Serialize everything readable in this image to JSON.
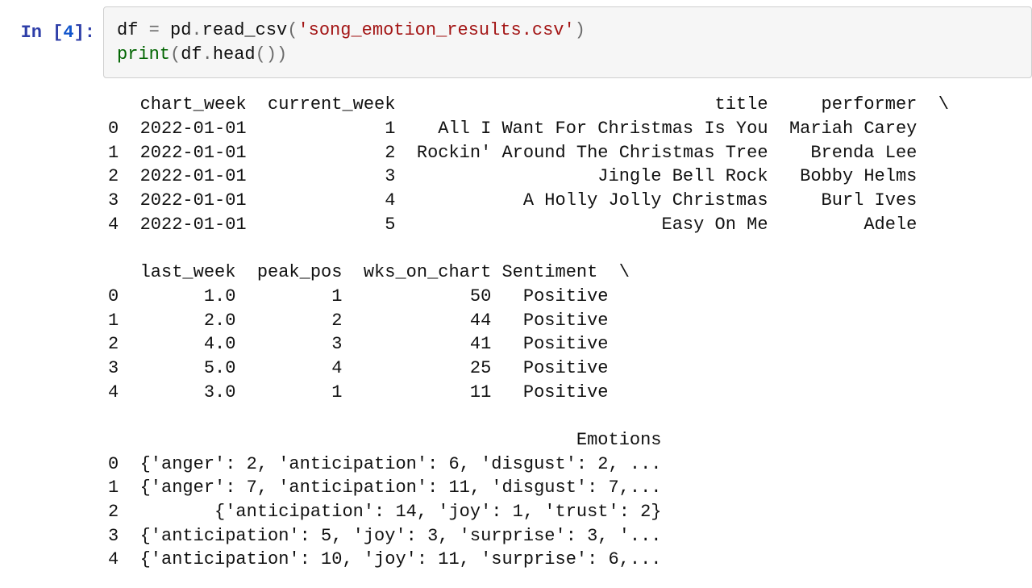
{
  "prompt": {
    "label_prefix": "In [",
    "number": "4",
    "label_suffix": "]:"
  },
  "code": {
    "line1": {
      "var": "df",
      "eq": " = ",
      "mod": "pd",
      "dot": ".",
      "fn": "read_csv",
      "open": "(",
      "str": "'song_emotion_results.csv'",
      "close": ")"
    },
    "line2": {
      "print": "print",
      "open": "(",
      "var": "df",
      "dot": ".",
      "fn": "head",
      "parens": "()",
      "close": ")"
    }
  },
  "output": {
    "block1": {
      "columns": [
        "chart_week",
        "current_week",
        "title",
        "performer"
      ],
      "continuation": "\\",
      "rows": [
        {
          "idx": "0",
          "chart_week": "2022-01-01",
          "current_week": "1",
          "title": "All I Want For Christmas Is You",
          "performer": "Mariah Carey"
        },
        {
          "idx": "1",
          "chart_week": "2022-01-01",
          "current_week": "2",
          "title": "Rockin' Around The Christmas Tree",
          "performer": "Brenda Lee"
        },
        {
          "idx": "2",
          "chart_week": "2022-01-01",
          "current_week": "3",
          "title": "Jingle Bell Rock",
          "performer": "Bobby Helms"
        },
        {
          "idx": "3",
          "chart_week": "2022-01-01",
          "current_week": "4",
          "title": "A Holly Jolly Christmas",
          "performer": "Burl Ives"
        },
        {
          "idx": "4",
          "chart_week": "2022-01-01",
          "current_week": "5",
          "title": "Easy On Me",
          "performer": "Adele"
        }
      ]
    },
    "block2": {
      "columns": [
        "last_week",
        "peak_pos",
        "wks_on_chart",
        "Sentiment"
      ],
      "continuation": "\\",
      "rows": [
        {
          "idx": "0",
          "last_week": "1.0",
          "peak_pos": "1",
          "wks_on_chart": "50",
          "Sentiment": "Positive"
        },
        {
          "idx": "1",
          "last_week": "2.0",
          "peak_pos": "2",
          "wks_on_chart": "44",
          "Sentiment": "Positive"
        },
        {
          "idx": "2",
          "last_week": "4.0",
          "peak_pos": "3",
          "wks_on_chart": "41",
          "Sentiment": "Positive"
        },
        {
          "idx": "3",
          "last_week": "5.0",
          "peak_pos": "4",
          "wks_on_chart": "25",
          "Sentiment": "Positive"
        },
        {
          "idx": "4",
          "last_week": "3.0",
          "peak_pos": "1",
          "wks_on_chart": "11",
          "Sentiment": "Positive"
        }
      ]
    },
    "block3": {
      "columns": [
        "Emotions"
      ],
      "rows": [
        {
          "idx": "0",
          "Emotions": "{'anger': 2, 'anticipation': 6, 'disgust': 2, ..."
        },
        {
          "idx": "1",
          "Emotions": "{'anger': 7, 'anticipation': 11, 'disgust': 7,..."
        },
        {
          "idx": "2",
          "Emotions": "{'anticipation': 14, 'joy': 1, 'trust': 2}"
        },
        {
          "idx": "3",
          "Emotions": "{'anticipation': 5, 'joy': 3, 'surprise': 3, '..."
        },
        {
          "idx": "4",
          "Emotions": "{'anticipation': 10, 'joy': 11, 'surprise': 6,..."
        }
      ]
    }
  }
}
